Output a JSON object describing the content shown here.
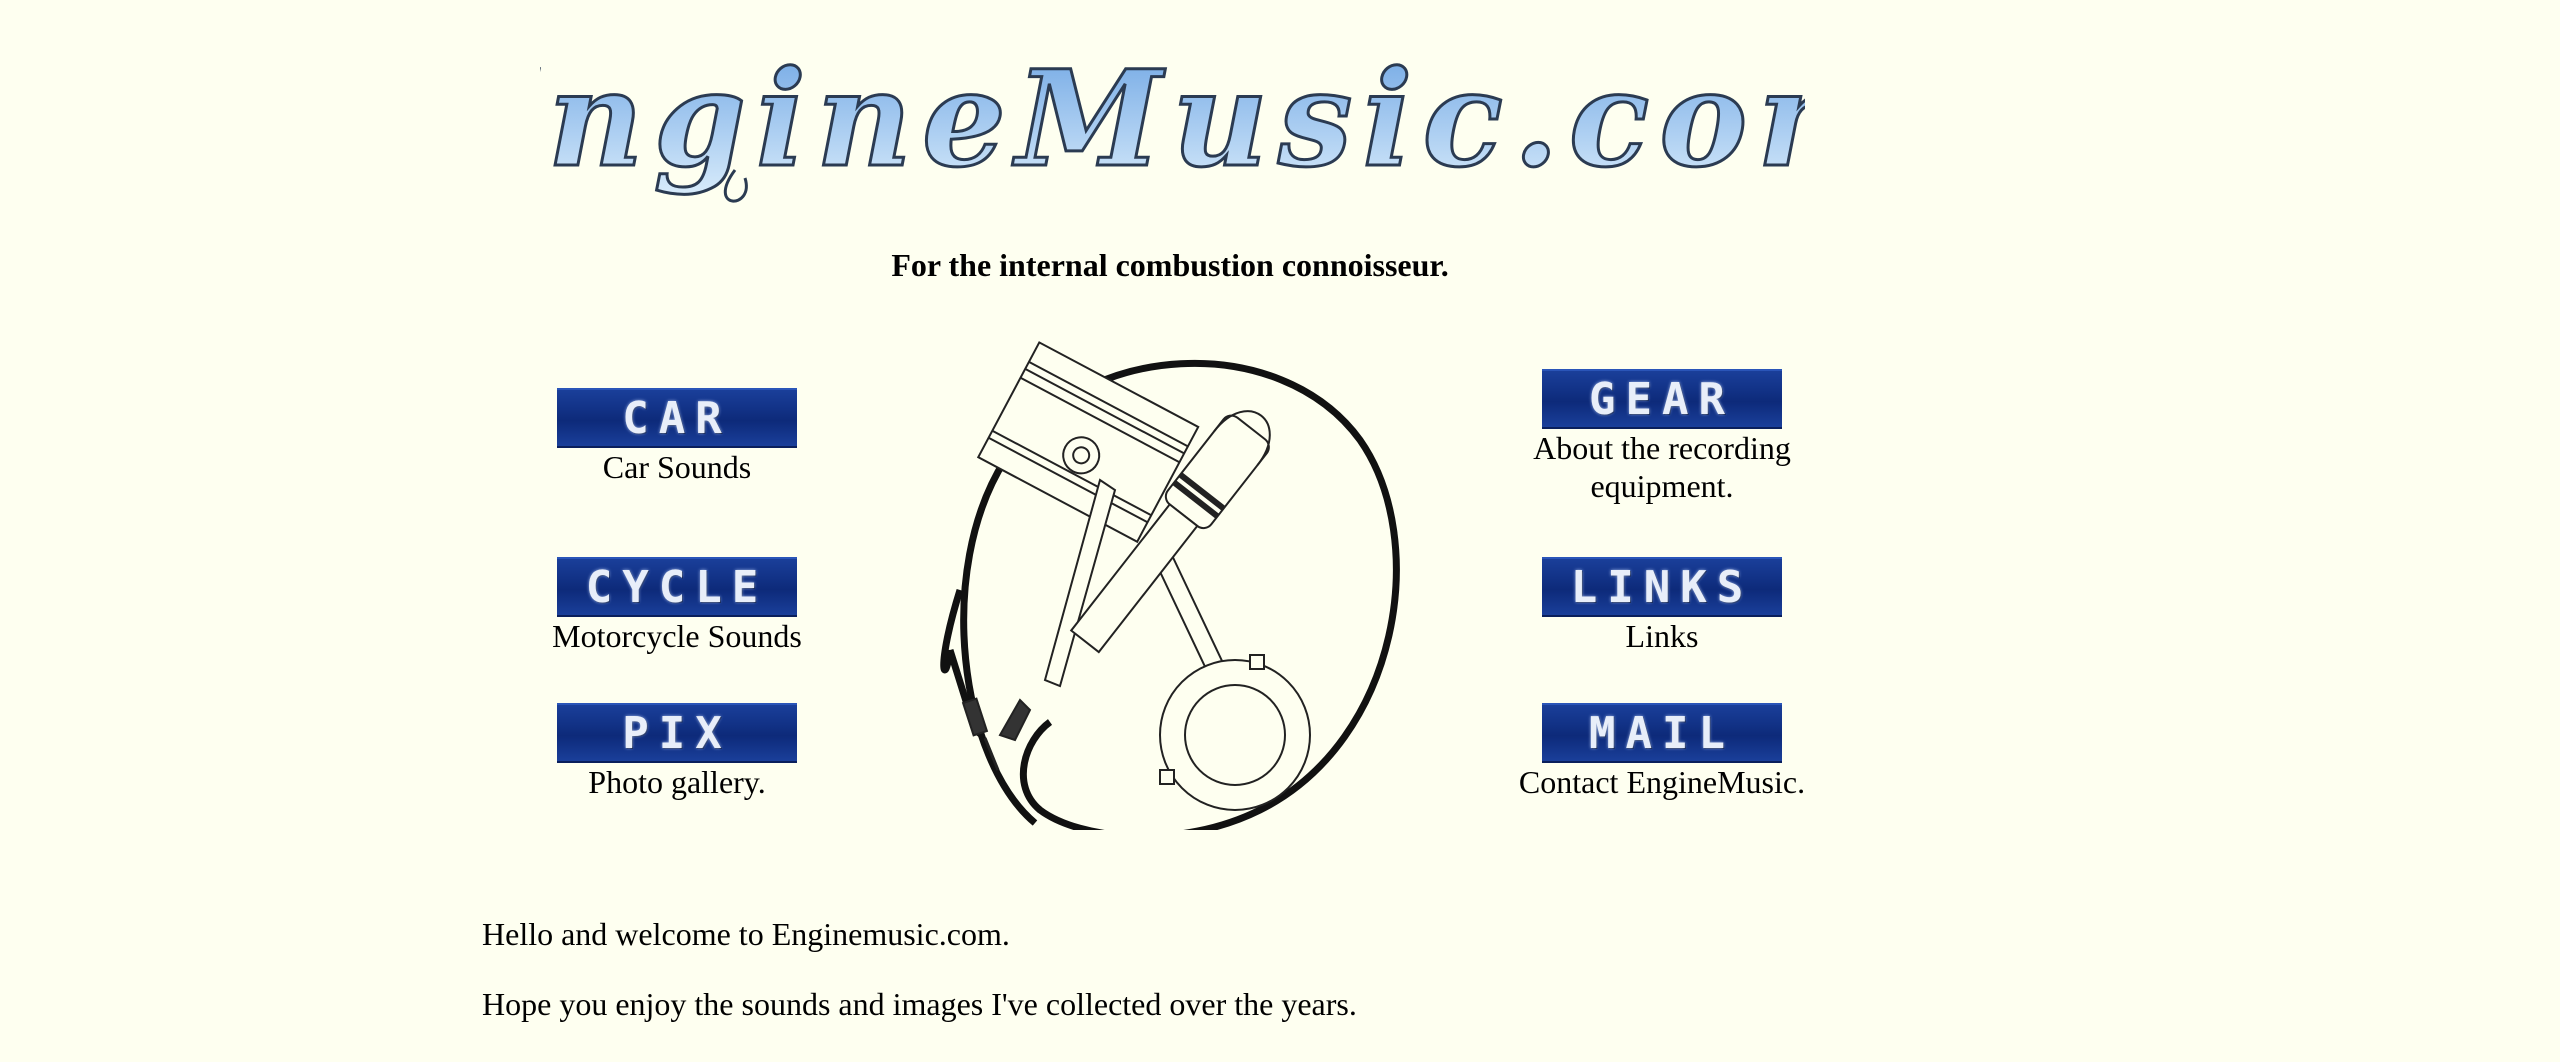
{
  "logo": {
    "text": "EngineMusic.com"
  },
  "tagline": "For the internal combustion connoisseur.",
  "nav": {
    "car": {
      "button": "CAR",
      "description": "Car Sounds"
    },
    "cycle": {
      "button": "CYCLE",
      "description": "Motorcycle Sounds"
    },
    "pix": {
      "button": "PIX",
      "description": "Photo gallery."
    },
    "gear": {
      "button": "GEAR",
      "description": "About the recording equipment."
    },
    "links": {
      "button": "LINKS",
      "description": "Links"
    },
    "mail": {
      "button": "MAIL",
      "description": "Contact EngineMusic."
    }
  },
  "intro": {
    "line1": "Hello and welcome to Enginemusic.com.",
    "line2": "Hope you enjoy the sounds and images I've collected over the years."
  },
  "colors": {
    "background": "#fefff0",
    "button_blue": "#0d2a7a",
    "logo_blue": "#7fb3e8"
  },
  "icons": {
    "center_art": "piston-microphone-icon"
  }
}
